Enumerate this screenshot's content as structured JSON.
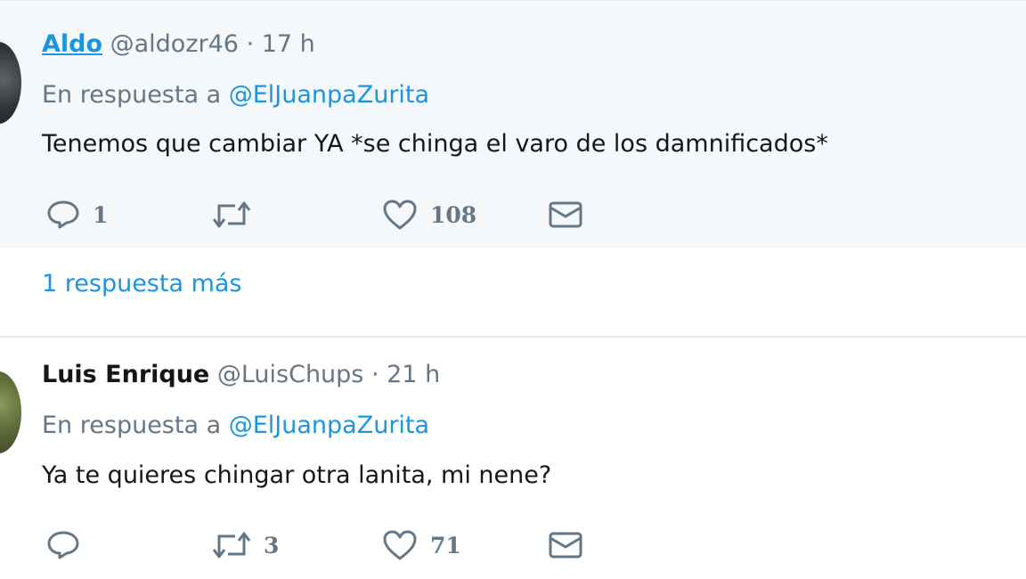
{
  "tweets": [
    {
      "name": "Aldo",
      "handle": "@aldozr46",
      "time": "· 17 h",
      "reply_prefix": "En respuesta a",
      "reply_handle": "@ElJuanpaZurita",
      "text": "Tenemos que cambiar YA *se chinga el varo de los damnificados*",
      "counts": {
        "replies": "1",
        "retweets": "",
        "likes": "108"
      }
    },
    {
      "name": "Luis Enrique",
      "handle": "@LuisChups",
      "time": "· 21 h",
      "reply_prefix": "En respuesta a",
      "reply_handle": "@ElJuanpaZurita",
      "text": "Ya te quieres chingar otra lanita, mi nene?",
      "counts": {
        "replies": "",
        "retweets": "3",
        "likes": "71"
      }
    }
  ],
  "more_replies_label": "1 respuesta más",
  "icons": [
    "reply-icon",
    "retweet-icon",
    "like-icon",
    "dm-icon"
  ],
  "colors": {
    "link": "#1b95e0",
    "muted": "#657786",
    "highlight_bg": "#f5f8fa"
  }
}
